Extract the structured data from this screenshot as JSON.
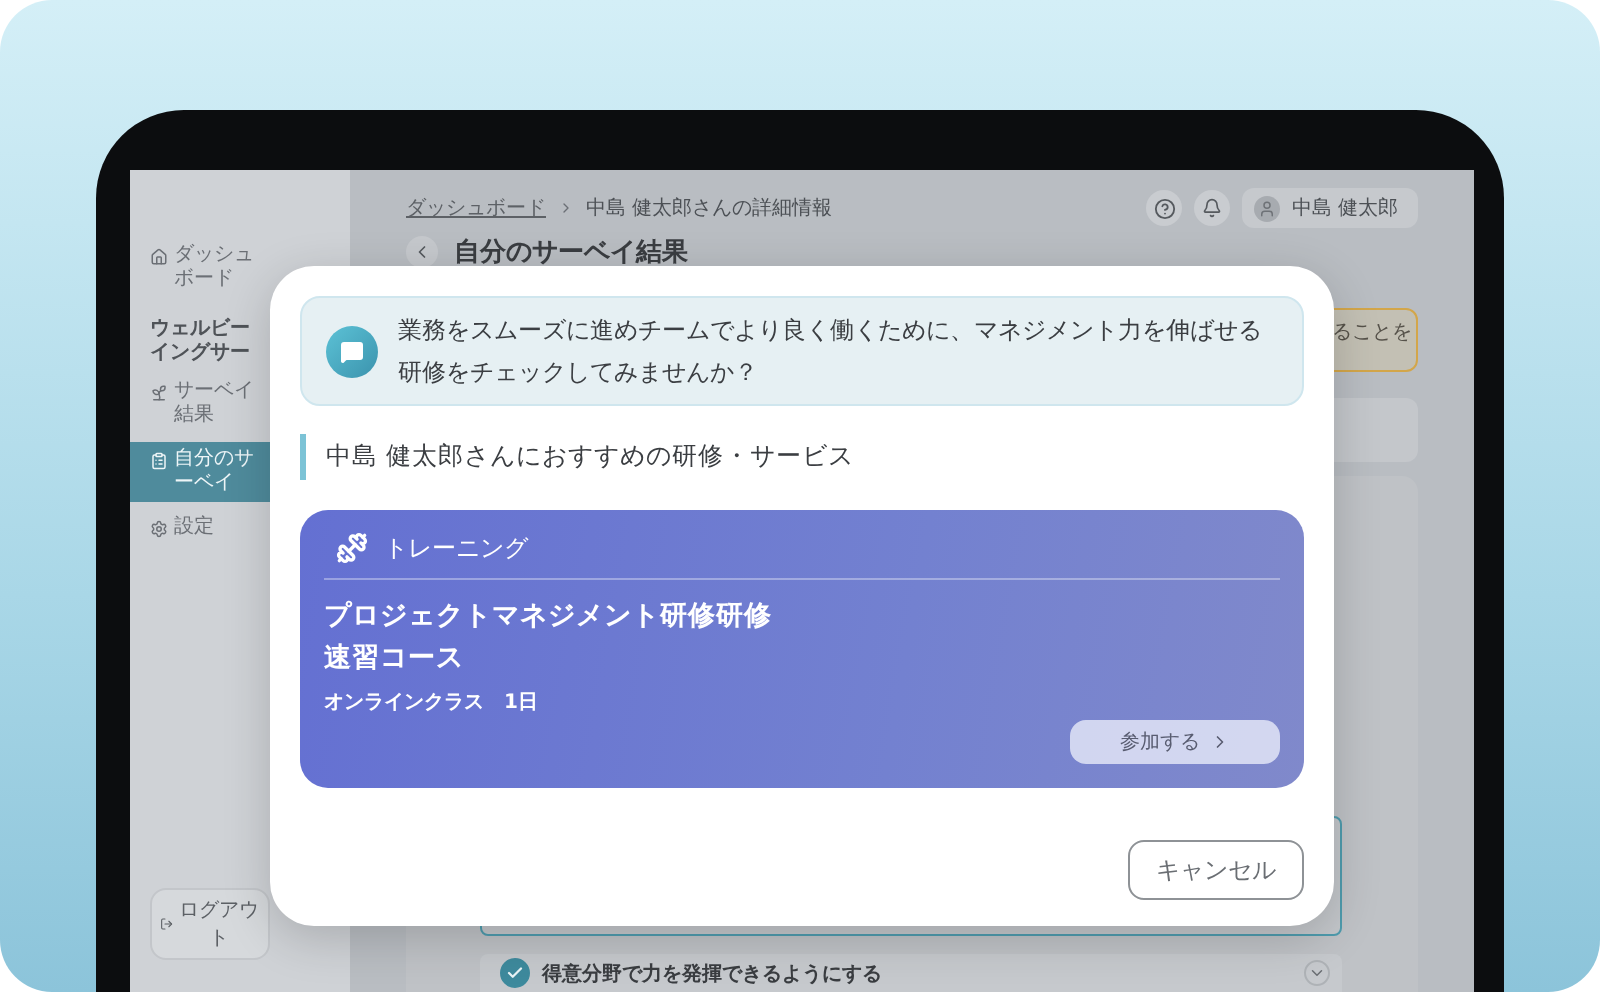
{
  "sidebar": {
    "items": [
      {
        "kind": "link",
        "label": "ダッシュボード",
        "selected": false
      },
      {
        "kind": "section",
        "label": "ウェルビーイングサー"
      },
      {
        "kind": "link",
        "label": "サーベイ結果",
        "selected": false
      },
      {
        "kind": "link",
        "label": "自分のサーベイ",
        "selected": true
      },
      {
        "kind": "link",
        "label": "設定",
        "selected": false
      }
    ],
    "logout": "ログアウト"
  },
  "breadcrumb": [
    "ダッシュボード",
    "中島 健太郎さんの詳細情報"
  ],
  "user": {
    "name": "中島 健太郎"
  },
  "page_title": "自分のサーベイ結果",
  "banner": {
    "text": "ることを"
  },
  "goals": [
    {
      "label": "得意分野で力を発揮できるようにする",
      "checked": true
    }
  ],
  "modal": {
    "message": "業務をスムーズに進めチームでより良く働くために、マネジメント力を伸ばせる研修をチェックしてみませんか？",
    "section_title": "中島 健太郎さんにおすすめの研修・サービス",
    "card": {
      "category": "トレーニング",
      "title_lines": [
        "プロジェクトマネジメント研修研修",
        "速習コース"
      ],
      "meta": "オンラインクラス　1日",
      "action": "参加する"
    },
    "cancel": "キャンセル"
  }
}
